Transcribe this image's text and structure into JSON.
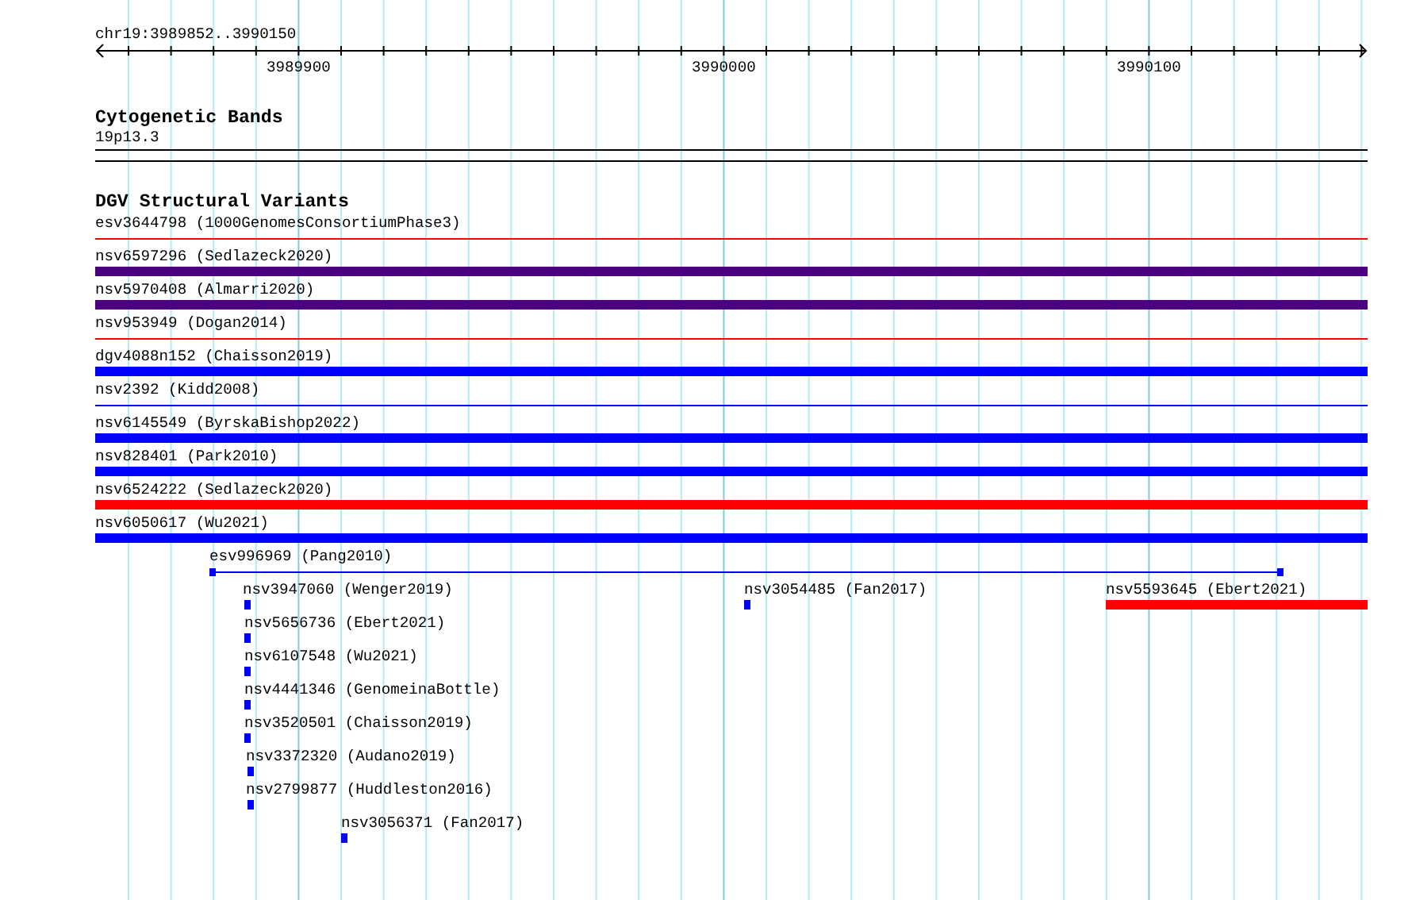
{
  "ruler": {
    "position": "chr19:3989852..3990150",
    "ticks": [
      "3989900",
      "3990000",
      "3990100"
    ]
  },
  "cytoband": {
    "title": "Cytogenetic Bands",
    "band": "19p13.3"
  },
  "dgv": {
    "title": "DGV Structural Variants",
    "rows": [
      {
        "features": [
          {
            "label": "esv3644798 (1000GenomesConsortiumPhase3)",
            "kind": "thin",
            "color": "#ff0000"
          }
        ]
      },
      {
        "features": [
          {
            "label": "nsv6597296 (Sedlazeck2020)",
            "kind": "thick",
            "color": "#4b0082"
          }
        ]
      },
      {
        "features": [
          {
            "label": "nsv5970408 (Almarri2020)",
            "kind": "thick",
            "color": "#4b0082"
          }
        ]
      },
      {
        "features": [
          {
            "label": "nsv953949 (Dogan2014)",
            "kind": "thin",
            "color": "#ff0000"
          }
        ]
      },
      {
        "features": [
          {
            "label": "dgv4088n152 (Chaisson2019)",
            "kind": "thick",
            "color": "#0000ff"
          }
        ]
      },
      {
        "features": [
          {
            "label": "nsv2392 (Kidd2008)",
            "kind": "thin",
            "color": "#0000ff"
          }
        ]
      },
      {
        "features": [
          {
            "label": "nsv6145549 (ByrskaBishop2022)",
            "kind": "thick",
            "color": "#0000ff"
          }
        ]
      },
      {
        "features": [
          {
            "label": "nsv828401 (Park2010)",
            "kind": "thick",
            "color": "#0000ff"
          }
        ]
      },
      {
        "features": [
          {
            "label": "nsv6524222 (Sedlazeck2020)",
            "kind": "thick",
            "color": "#ff0000"
          }
        ]
      },
      {
        "features": [
          {
            "label": "nsv6050617 (Wu2021)",
            "kind": "thick",
            "color": "#0000ff"
          }
        ]
      },
      {
        "features": [
          {
            "label": "esv996969 (Pang2010)",
            "kind": "gapped",
            "color": "#0000ff"
          }
        ]
      },
      {
        "features": [
          {
            "label": "nsv3947060 (Wenger2019)",
            "kind": "thick",
            "color": "#0000ff"
          },
          {
            "label": "nsv3054485 (Fan2017)",
            "kind": "thick",
            "color": "#0000ff"
          },
          {
            "label": "nsv5593645 (Ebert2021)",
            "kind": "thick",
            "color": "#ff0000"
          }
        ]
      },
      {
        "features": [
          {
            "label": "nsv5656736 (Ebert2021)",
            "kind": "thick",
            "color": "#0000ff"
          }
        ]
      },
      {
        "features": [
          {
            "label": "nsv6107548 (Wu2021)",
            "kind": "thick",
            "color": "#0000ff"
          }
        ]
      },
      {
        "features": [
          {
            "label": "nsv4441346 (GenomeinaBottle)",
            "kind": "thick",
            "color": "#0000ff"
          }
        ]
      },
      {
        "features": [
          {
            "label": "nsv3520501 (Chaisson2019)",
            "kind": "thick",
            "color": "#0000ff"
          }
        ]
      },
      {
        "features": [
          {
            "label": "nsv3372320 (Audano2019)",
            "kind": "thick",
            "color": "#0000ff"
          }
        ]
      },
      {
        "features": [
          {
            "label": "nsv2799877 (Huddleston2016)",
            "kind": "thick",
            "color": "#0000ff"
          }
        ]
      },
      {
        "features": [
          {
            "label": "nsv3056371 (Fan2017)",
            "kind": "thick",
            "color": "#0000ff"
          }
        ]
      }
    ]
  }
}
